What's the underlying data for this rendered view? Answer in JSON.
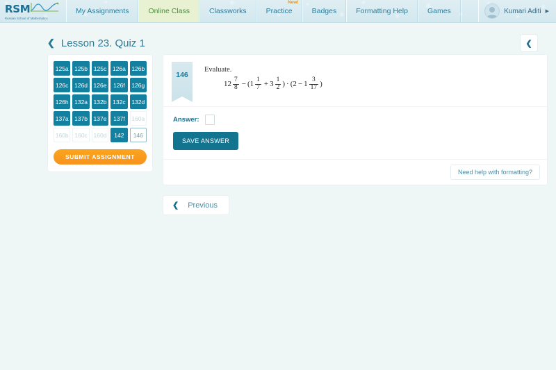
{
  "brand": {
    "name": "RSM",
    "tagline": "Russian School of Mathematics",
    "logo_icon": "rsm-wave-logo"
  },
  "nav": {
    "items": [
      {
        "label": "My Assignments",
        "active": false,
        "badge": ""
      },
      {
        "label": "Online Class",
        "active": true,
        "badge": ""
      },
      {
        "label": "Classworks",
        "active": false,
        "badge": ""
      },
      {
        "label": "Practice",
        "active": false,
        "badge": "New!"
      },
      {
        "label": "Badges",
        "active": false,
        "badge": ""
      },
      {
        "label": "Formatting Help",
        "active": false,
        "badge": ""
      },
      {
        "label": "Games",
        "active": false,
        "badge": ""
      }
    ],
    "user": {
      "name": "Kumari Aditi",
      "avatar_icon": "user-avatar-icon",
      "caret_icon": "caret-right-icon"
    }
  },
  "header": {
    "back_icon": "chevron-left-icon",
    "title": "Lesson 23. Quiz 1",
    "collapse_icon": "chevron-left-icon"
  },
  "sidebar": {
    "questions": [
      {
        "label": "125a",
        "state": "done"
      },
      {
        "label": "125b",
        "state": "done"
      },
      {
        "label": "125c",
        "state": "done"
      },
      {
        "label": "126a",
        "state": "done"
      },
      {
        "label": "126b",
        "state": "done"
      },
      {
        "label": "126c",
        "state": "done"
      },
      {
        "label": "126d",
        "state": "done"
      },
      {
        "label": "126e",
        "state": "done"
      },
      {
        "label": "126f",
        "state": "done"
      },
      {
        "label": "126g",
        "state": "done"
      },
      {
        "label": "126h",
        "state": "done"
      },
      {
        "label": "132a",
        "state": "done"
      },
      {
        "label": "132b",
        "state": "done"
      },
      {
        "label": "132c",
        "state": "done"
      },
      {
        "label": "132d",
        "state": "done"
      },
      {
        "label": "137a",
        "state": "done"
      },
      {
        "label": "137b",
        "state": "done"
      },
      {
        "label": "137e",
        "state": "done"
      },
      {
        "label": "137f",
        "state": "done"
      },
      {
        "label": "160a",
        "state": "todo"
      },
      {
        "label": "160b",
        "state": "todo"
      },
      {
        "label": "160c",
        "state": "todo"
      },
      {
        "label": "160d",
        "state": "todo"
      },
      {
        "label": "142",
        "state": "done"
      },
      {
        "label": "146",
        "state": "current"
      }
    ],
    "submit_label": "SUBMIT ASSIGNMENT"
  },
  "question": {
    "number": "146",
    "prompt": "Evaluate.",
    "expression_plain": "12 7/8 - (1 1/7 + 3 1/2) · (2 - 1 3/17)",
    "expression_parts": {
      "whole1": "12",
      "frac1_num": "7",
      "frac1_den": "8",
      "minus": "−",
      "open1": "(",
      "whole2": "1",
      "frac2_num": "1",
      "frac2_den": "7",
      "plus": "+",
      "whole3": "3",
      "frac3_num": "1",
      "frac3_den": "2",
      "close1": ")",
      "times": "·",
      "open2": "(",
      "whole4": "2",
      "minus2": "−",
      "whole5": "1",
      "frac4_num": "3",
      "frac4_den": "17",
      "close2": ")"
    }
  },
  "answer": {
    "label": "Answer:",
    "value": "",
    "placeholder": "",
    "save_label": "SAVE ANSWER"
  },
  "footer": {
    "format_help_label": "Need help with formatting?"
  },
  "pagination": {
    "prev_label": "Previous",
    "prev_icon": "chevron-left-icon"
  },
  "colors": {
    "accent_teal": "#12748f",
    "cell_done": "#1380a0",
    "submit_orange": "#f7921e",
    "active_tab": "#e8f2d2",
    "page_bg": "#eff6f6"
  }
}
